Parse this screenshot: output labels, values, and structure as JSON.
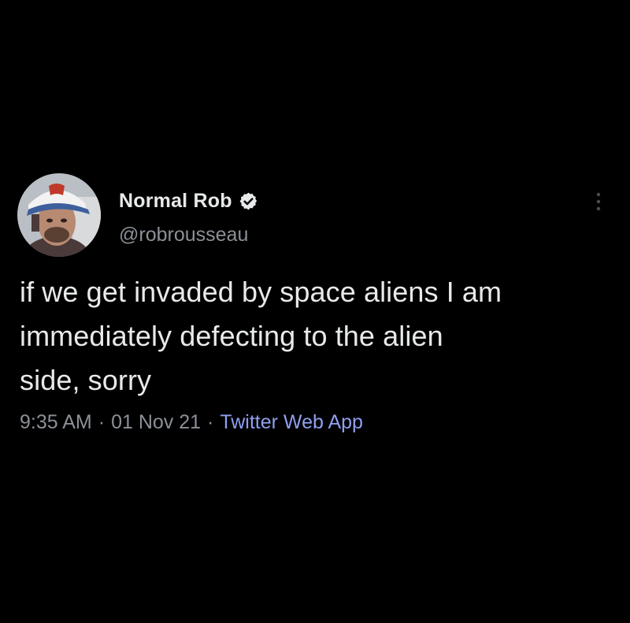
{
  "tweet": {
    "author": {
      "display_name": "Normal Rob",
      "handle": "@robrousseau",
      "verified": true
    },
    "text_lines": [
      "if we get invaded by space aliens I am",
      "immediately defecting to the alien",
      "side, sorry"
    ],
    "time": "9:35 AM",
    "separator": "·",
    "date": "01 Nov 21",
    "source": "Twitter Web App"
  },
  "icons": {
    "verified": "verified-badge-icon",
    "more": "more-options-icon"
  },
  "colors": {
    "background": "#000000",
    "primary_text": "#e7e9ea",
    "secondary_text": "#8b9096",
    "link": "#8f9ff0",
    "verified_badge": "#e7e9ea"
  }
}
